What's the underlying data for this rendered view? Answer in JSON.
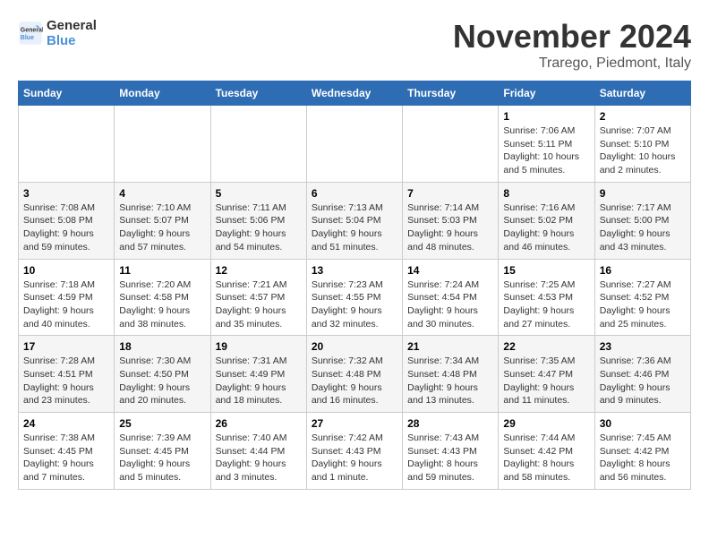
{
  "logo": {
    "line1": "General",
    "line2": "Blue"
  },
  "title": "November 2024",
  "location": "Trarego, Piedmont, Italy",
  "header_days": [
    "Sunday",
    "Monday",
    "Tuesday",
    "Wednesday",
    "Thursday",
    "Friday",
    "Saturday"
  ],
  "weeks": [
    [
      {
        "day": "",
        "info": ""
      },
      {
        "day": "",
        "info": ""
      },
      {
        "day": "",
        "info": ""
      },
      {
        "day": "",
        "info": ""
      },
      {
        "day": "",
        "info": ""
      },
      {
        "day": "1",
        "info": "Sunrise: 7:06 AM\nSunset: 5:11 PM\nDaylight: 10 hours and 5 minutes."
      },
      {
        "day": "2",
        "info": "Sunrise: 7:07 AM\nSunset: 5:10 PM\nDaylight: 10 hours and 2 minutes."
      }
    ],
    [
      {
        "day": "3",
        "info": "Sunrise: 7:08 AM\nSunset: 5:08 PM\nDaylight: 9 hours and 59 minutes."
      },
      {
        "day": "4",
        "info": "Sunrise: 7:10 AM\nSunset: 5:07 PM\nDaylight: 9 hours and 57 minutes."
      },
      {
        "day": "5",
        "info": "Sunrise: 7:11 AM\nSunset: 5:06 PM\nDaylight: 9 hours and 54 minutes."
      },
      {
        "day": "6",
        "info": "Sunrise: 7:13 AM\nSunset: 5:04 PM\nDaylight: 9 hours and 51 minutes."
      },
      {
        "day": "7",
        "info": "Sunrise: 7:14 AM\nSunset: 5:03 PM\nDaylight: 9 hours and 48 minutes."
      },
      {
        "day": "8",
        "info": "Sunrise: 7:16 AM\nSunset: 5:02 PM\nDaylight: 9 hours and 46 minutes."
      },
      {
        "day": "9",
        "info": "Sunrise: 7:17 AM\nSunset: 5:00 PM\nDaylight: 9 hours and 43 minutes."
      }
    ],
    [
      {
        "day": "10",
        "info": "Sunrise: 7:18 AM\nSunset: 4:59 PM\nDaylight: 9 hours and 40 minutes."
      },
      {
        "day": "11",
        "info": "Sunrise: 7:20 AM\nSunset: 4:58 PM\nDaylight: 9 hours and 38 minutes."
      },
      {
        "day": "12",
        "info": "Sunrise: 7:21 AM\nSunset: 4:57 PM\nDaylight: 9 hours and 35 minutes."
      },
      {
        "day": "13",
        "info": "Sunrise: 7:23 AM\nSunset: 4:55 PM\nDaylight: 9 hours and 32 minutes."
      },
      {
        "day": "14",
        "info": "Sunrise: 7:24 AM\nSunset: 4:54 PM\nDaylight: 9 hours and 30 minutes."
      },
      {
        "day": "15",
        "info": "Sunrise: 7:25 AM\nSunset: 4:53 PM\nDaylight: 9 hours and 27 minutes."
      },
      {
        "day": "16",
        "info": "Sunrise: 7:27 AM\nSunset: 4:52 PM\nDaylight: 9 hours and 25 minutes."
      }
    ],
    [
      {
        "day": "17",
        "info": "Sunrise: 7:28 AM\nSunset: 4:51 PM\nDaylight: 9 hours and 23 minutes."
      },
      {
        "day": "18",
        "info": "Sunrise: 7:30 AM\nSunset: 4:50 PM\nDaylight: 9 hours and 20 minutes."
      },
      {
        "day": "19",
        "info": "Sunrise: 7:31 AM\nSunset: 4:49 PM\nDaylight: 9 hours and 18 minutes."
      },
      {
        "day": "20",
        "info": "Sunrise: 7:32 AM\nSunset: 4:48 PM\nDaylight: 9 hours and 16 minutes."
      },
      {
        "day": "21",
        "info": "Sunrise: 7:34 AM\nSunset: 4:48 PM\nDaylight: 9 hours and 13 minutes."
      },
      {
        "day": "22",
        "info": "Sunrise: 7:35 AM\nSunset: 4:47 PM\nDaylight: 9 hours and 11 minutes."
      },
      {
        "day": "23",
        "info": "Sunrise: 7:36 AM\nSunset: 4:46 PM\nDaylight: 9 hours and 9 minutes."
      }
    ],
    [
      {
        "day": "24",
        "info": "Sunrise: 7:38 AM\nSunset: 4:45 PM\nDaylight: 9 hours and 7 minutes."
      },
      {
        "day": "25",
        "info": "Sunrise: 7:39 AM\nSunset: 4:45 PM\nDaylight: 9 hours and 5 minutes."
      },
      {
        "day": "26",
        "info": "Sunrise: 7:40 AM\nSunset: 4:44 PM\nDaylight: 9 hours and 3 minutes."
      },
      {
        "day": "27",
        "info": "Sunrise: 7:42 AM\nSunset: 4:43 PM\nDaylight: 9 hours and 1 minute."
      },
      {
        "day": "28",
        "info": "Sunrise: 7:43 AM\nSunset: 4:43 PM\nDaylight: 8 hours and 59 minutes."
      },
      {
        "day": "29",
        "info": "Sunrise: 7:44 AM\nSunset: 4:42 PM\nDaylight: 8 hours and 58 minutes."
      },
      {
        "day": "30",
        "info": "Sunrise: 7:45 AM\nSunset: 4:42 PM\nDaylight: 8 hours and 56 minutes."
      }
    ]
  ]
}
